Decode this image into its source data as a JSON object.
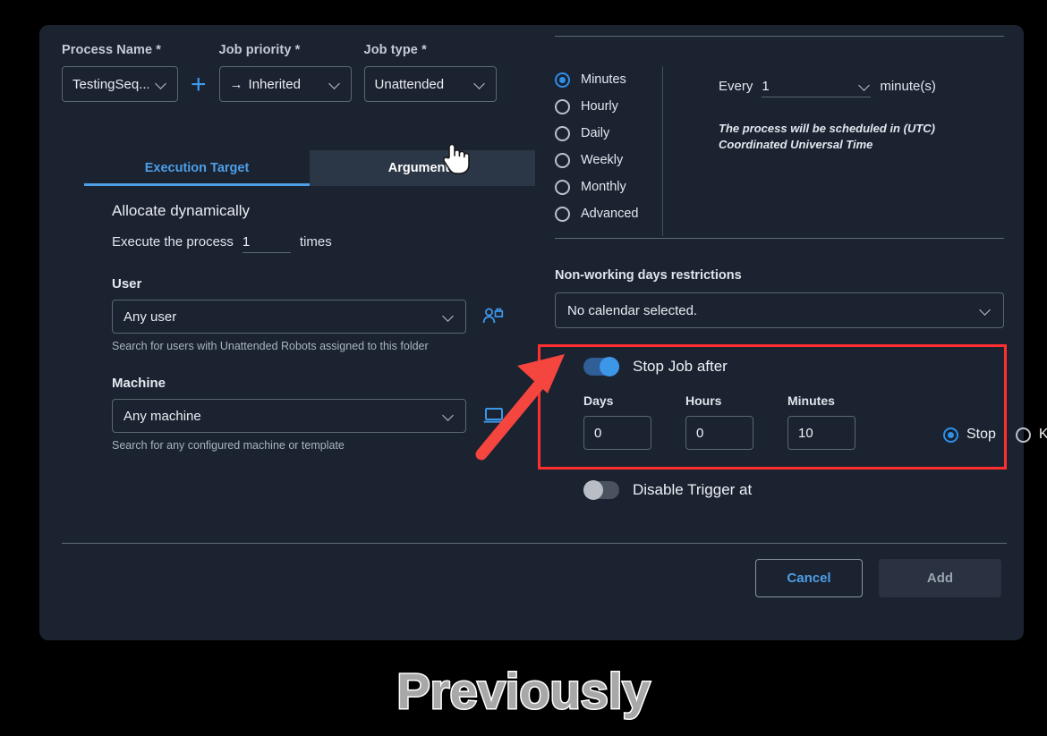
{
  "dialog": {
    "process_name": {
      "label": "Process Name *",
      "value": "TestingSeq...",
      "add_button": "+"
    },
    "job_priority": {
      "label": "Job priority *",
      "value": "Inherited",
      "prefix_icon": "arrow-right-icon"
    },
    "job_type": {
      "label": "Job type *",
      "value": "Unattended"
    },
    "tabs": [
      {
        "label": "Execution Target",
        "state": "active"
      },
      {
        "label": "Arguments",
        "state": "hover"
      }
    ],
    "execution_target": {
      "allocate_title": "Allocate dynamically",
      "execute_prefix": "Execute the process",
      "execute_times_value": "1",
      "execute_suffix": "times",
      "user_label": "User",
      "user_value": "Any user",
      "user_hint": "Search for users with Unattended Robots assigned to this folder",
      "user_icon": "user-add-icon",
      "machine_label": "Machine",
      "machine_value": "Any machine",
      "machine_hint": "Search for any configured machine or template",
      "machine_icon": "laptop-icon"
    },
    "schedule": {
      "frequency_options": [
        {
          "label": "Minutes",
          "selected": true
        },
        {
          "label": "Hourly",
          "selected": false
        },
        {
          "label": "Daily",
          "selected": false
        },
        {
          "label": "Weekly",
          "selected": false
        },
        {
          "label": "Monthly",
          "selected": false
        },
        {
          "label": "Advanced",
          "selected": false
        }
      ],
      "every_prefix": "Every",
      "every_value": "1",
      "every_suffix": "minute(s)",
      "timezone_note": "The process will be scheduled in (UTC) Coordinated Universal Time"
    },
    "non_working_days": {
      "title": "Non-working days restrictions",
      "value": "No calendar selected."
    },
    "stop_job_after": {
      "toggle_label": "Stop Job after",
      "toggle_state": "on",
      "days_label": "Days",
      "days_value": "0",
      "hours_label": "Hours",
      "hours_value": "0",
      "minutes_label": "Minutes",
      "minutes_value": "10",
      "actions": [
        {
          "label": "Stop",
          "selected": true
        },
        {
          "label": "Kill",
          "selected": false
        }
      ]
    },
    "disable_trigger": {
      "toggle_label": "Disable Trigger at",
      "toggle_state": "off"
    },
    "footer": {
      "cancel_label": "Cancel",
      "add_label": "Add"
    }
  },
  "annotations": {
    "highlight_color": "#ff2f2f",
    "arrow_color": "#f4453f",
    "caption": "Previously",
    "cursor": "pointer-hand-cursor"
  },
  "colors": {
    "page_background": "#000000",
    "dialog_background": "#1b2230",
    "accent_blue": "#3d97e8",
    "tab_active": "#4d9fe8",
    "border": "#5b6677"
  }
}
